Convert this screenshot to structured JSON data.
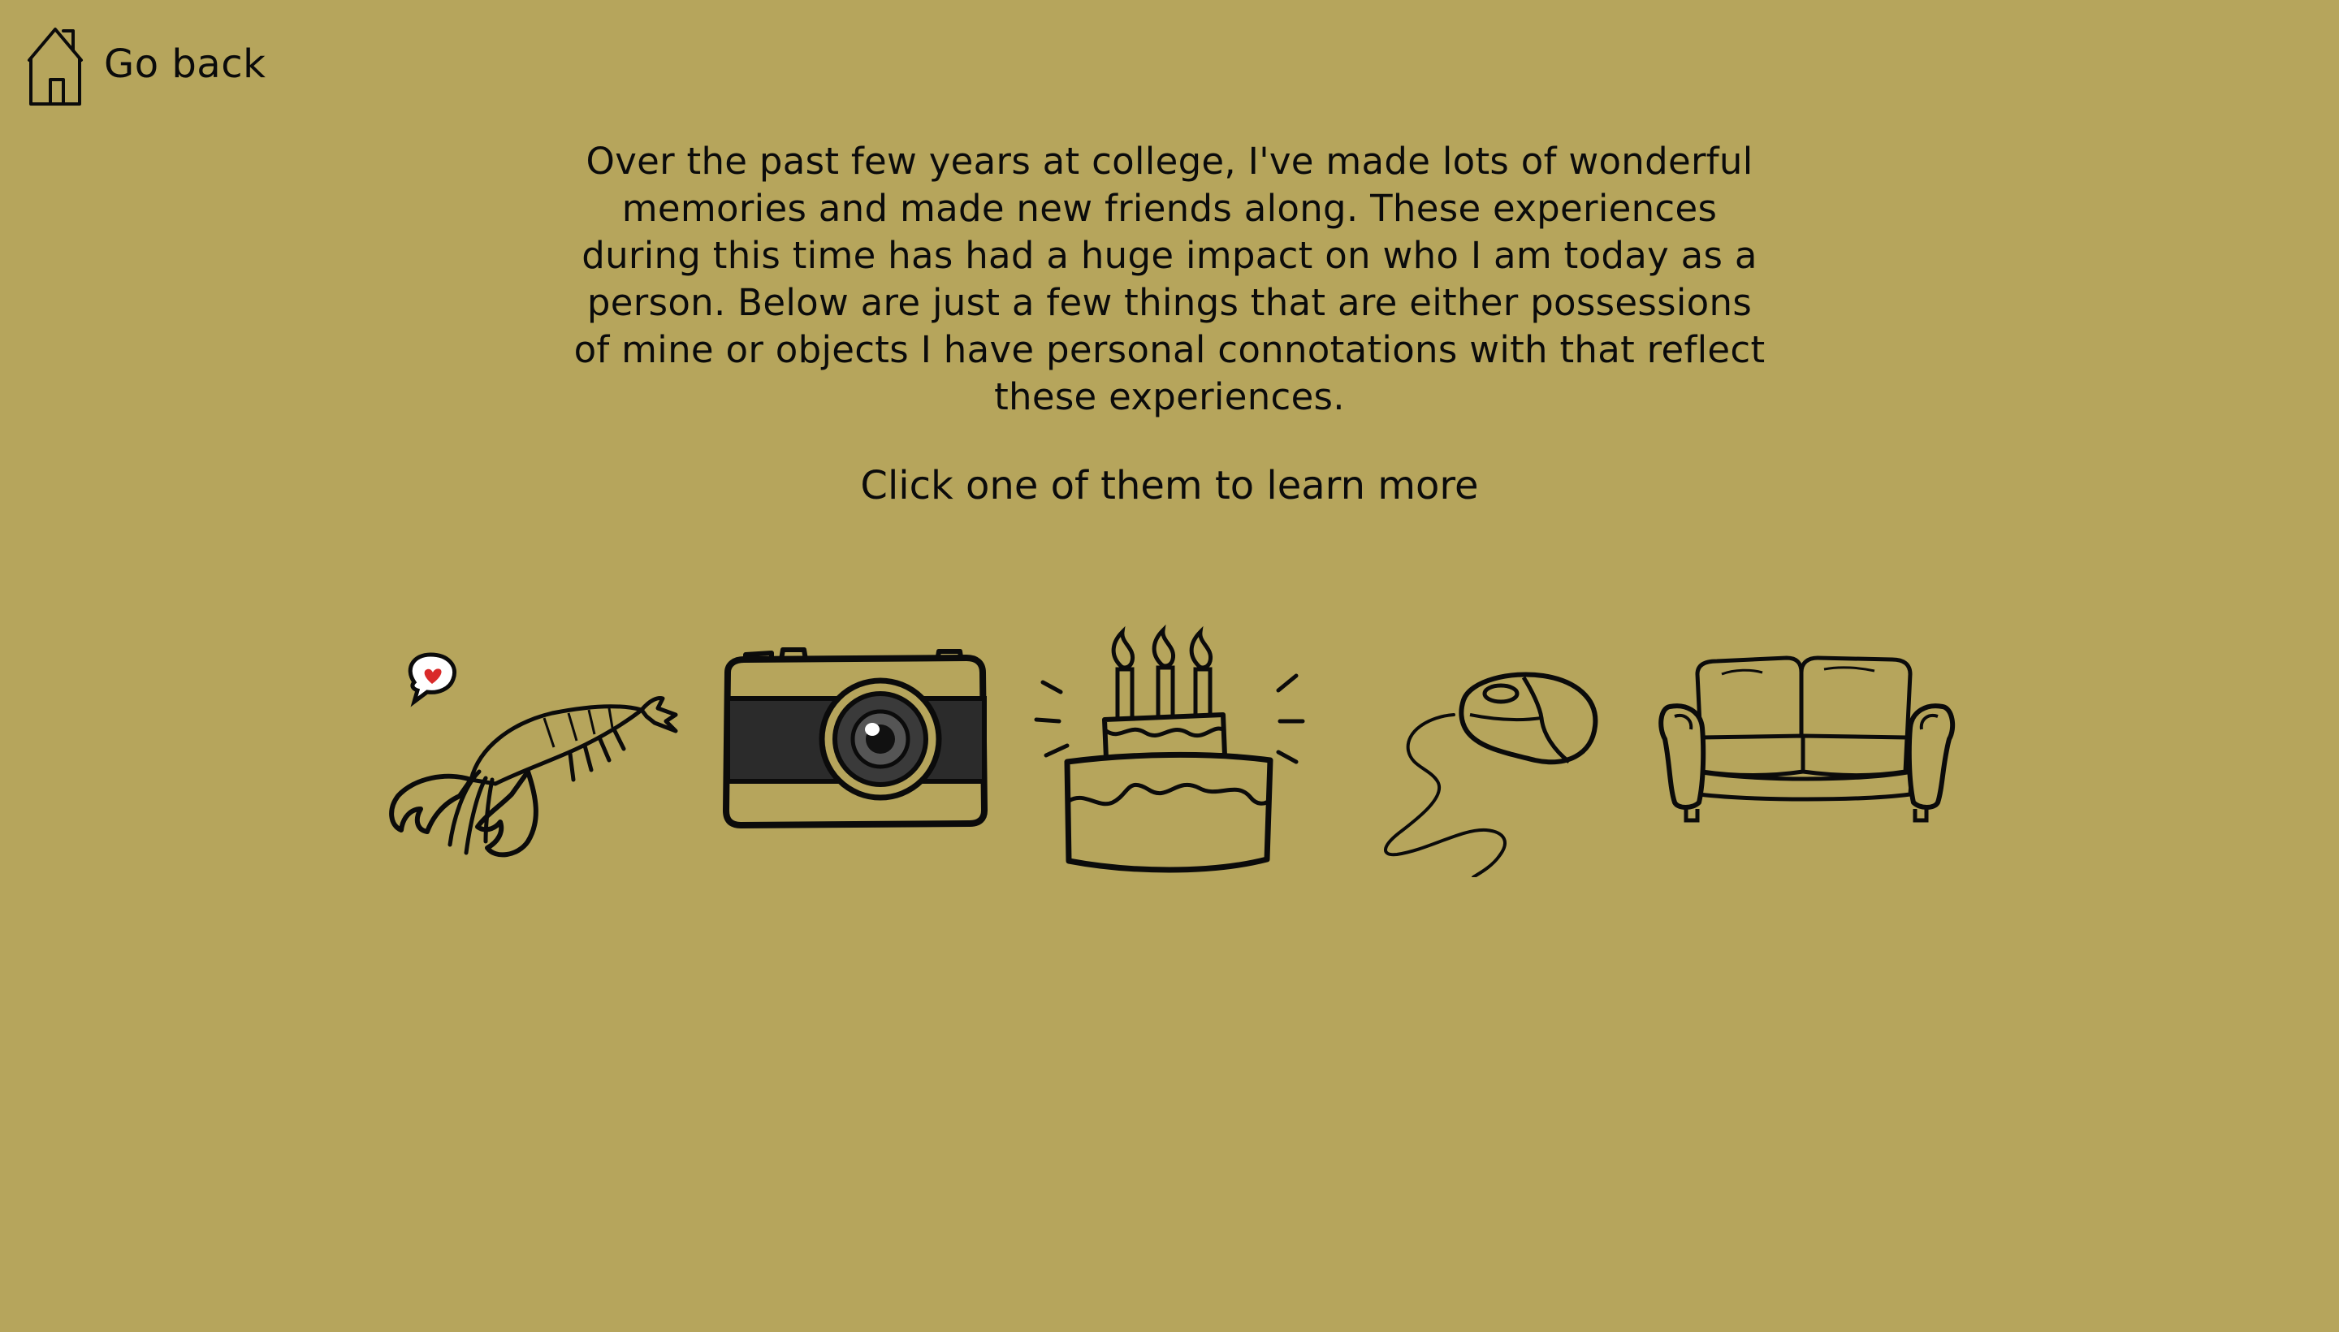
{
  "nav": {
    "back_label": "Go back",
    "home_icon": "home-icon"
  },
  "intro": {
    "paragraph": "Over the past few years at college, I've made lots of wonderful memories and made new friends along. These experiences during this time has had a huge impact on who I am today as a person. Below are just a few things that are either possessions of mine or objects I have personal connotations with that reflect these experiences.",
    "call_to_action": "Click one of them to learn more"
  },
  "objects": [
    {
      "id": "lobster",
      "icon": "lobster-icon"
    },
    {
      "id": "camera",
      "icon": "camera-icon"
    },
    {
      "id": "cake",
      "icon": "birthday-cake-icon"
    },
    {
      "id": "mouse",
      "icon": "computer-mouse-icon"
    },
    {
      "id": "couch",
      "icon": "couch-icon"
    }
  ],
  "colors": {
    "background": "#b6a55c",
    "ink": "#0b0b0b",
    "heart": "#d92a2a",
    "camera_body": "#b6a55c",
    "camera_band": "#2b2b2b"
  }
}
